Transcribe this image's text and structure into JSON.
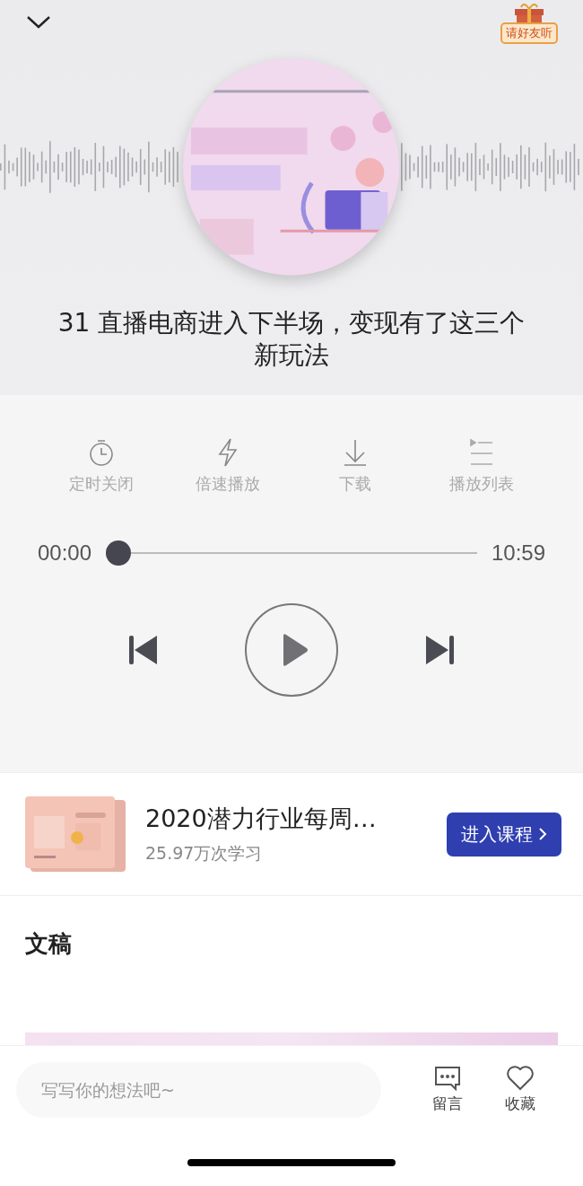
{
  "header": {
    "invite_badge": "请好友听"
  },
  "episode_title": "31 直播电商进入下半场，变现有了这三个新玩法",
  "actions": [
    {
      "kind": "timer",
      "label": "定时关闭"
    },
    {
      "kind": "speed",
      "label": "倍速播放"
    },
    {
      "kind": "download",
      "label": "下载"
    },
    {
      "kind": "playlist",
      "label": "播放列表"
    }
  ],
  "player": {
    "elapsed": "00:00",
    "duration": "10:59",
    "progress": {
      "level": 0
    },
    "playing": false
  },
  "course": {
    "title": "2020潜力行业每周…",
    "learners": "25.97万次学习",
    "button": "进入课程"
  },
  "transcript": {
    "heading": "文稿"
  },
  "bottom_bar": {
    "comment_placeholder": "写写你的想法吧~",
    "actions": [
      {
        "kind": "comment",
        "label": "留言"
      },
      {
        "kind": "favorite",
        "label": "收藏"
      }
    ]
  }
}
